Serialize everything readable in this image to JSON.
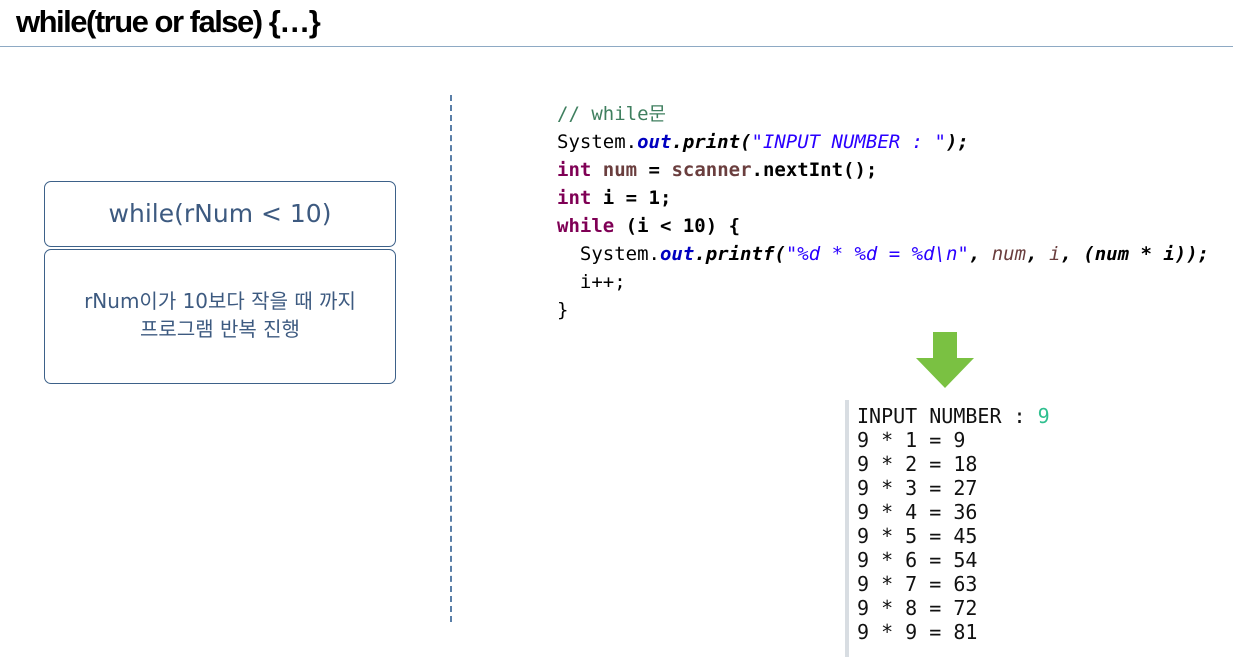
{
  "title": "while(true or false) {…}",
  "diagram": {
    "condition": "while(rNum < 10)",
    "description_line1": "rNum이가 10보다 작을 때 까지",
    "description_line2": "프로그램 반복 진행"
  },
  "code": {
    "comment": "// while문",
    "l2_system": "System.",
    "l2_out": "out",
    "l2_print": ".print(",
    "l2_string": "\"INPUT NUMBER : \"",
    "l2_end": ");",
    "l3_int": "int",
    "l3_var": "num",
    "l3_eq": " = ",
    "l3_scanner": "scanner",
    "l3_call": ".nextInt();",
    "l4_int": "int",
    "l4_rest": " i = 1;",
    "l5_while": "while",
    "l5_rest": " (i < 10) {",
    "l6_system": "System.",
    "l6_out": "out",
    "l6_printf": ".printf(",
    "l6_string": "\"%d * %d = %d\\n\"",
    "l6_comma1": ", ",
    "l6_num": "num",
    "l6_comma2": ", ",
    "l6_i": "i",
    "l6_comma3": ", ",
    "l6_expr": "(num * i));",
    "l7": "i++;",
    "l8": "}"
  },
  "arrow_color": "#7ac142",
  "console": {
    "prompt": "INPUT NUMBER : ",
    "input": "9",
    "lines": [
      "9 * 1 = 9",
      "9 * 2 = 18",
      "9 * 3 = 27",
      "9 * 4 = 36",
      "9 * 5 = 45",
      "9 * 6 = 54",
      "9 * 7 = 63",
      "9 * 8 = 72",
      "9 * 9 = 81"
    ]
  }
}
